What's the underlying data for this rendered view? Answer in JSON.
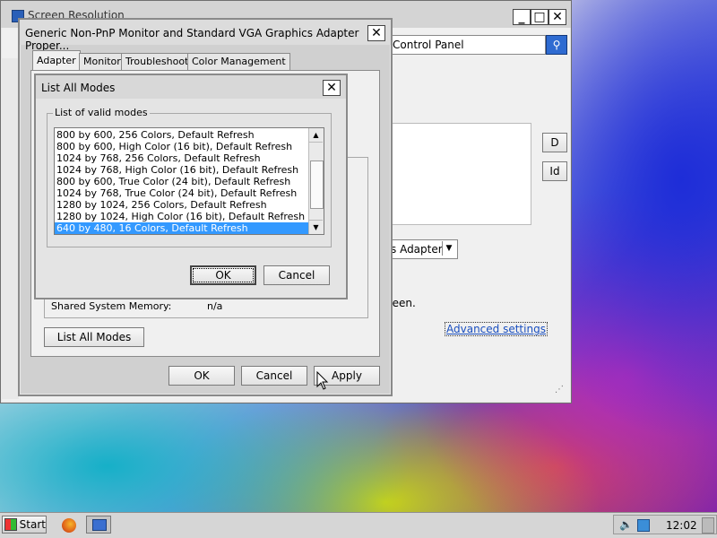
{
  "bg_window": {
    "title": "Screen Resolution",
    "address_text": "Control Panel",
    "partial_btn1": "D",
    "partial_btn2": "Id",
    "adapter_dropdown": "s Adapter",
    "partial_text": "reen.",
    "advanced_link": "Advanced settings"
  },
  "props_dialog": {
    "title": "Generic Non-PnP Monitor and Standard VGA Graphics Adapter Proper...",
    "tabs": [
      "Adapter",
      "Monitor",
      "Troubleshoot",
      "Color Management"
    ],
    "shared_memory_label": "Shared System Memory:",
    "shared_memory_value": "n/a",
    "list_all_modes": "List All Modes",
    "ok": "OK",
    "cancel": "Cancel",
    "apply": "Apply"
  },
  "modes_dialog": {
    "title": "List All Modes",
    "group_label": "List of valid modes",
    "modes": [
      "800 by 600, 256 Colors, Default Refresh",
      "800 by 600, High Color (16 bit), Default Refresh",
      "1024 by 768, 256 Colors, Default Refresh",
      "1024 by 768, High Color (16 bit), Default Refresh",
      "800 by 600, True Color (24 bit), Default Refresh",
      "1024 by 768, True Color (24 bit), Default Refresh",
      "1280 by 1024, 256 Colors, Default Refresh",
      "1280 by 1024, High Color (16 bit), Default Refresh",
      "640 by 480, 16 Colors, Default Refresh"
    ],
    "ok": "OK",
    "cancel": "Cancel"
  },
  "taskbar": {
    "start": "Start",
    "clock": "12:02"
  }
}
